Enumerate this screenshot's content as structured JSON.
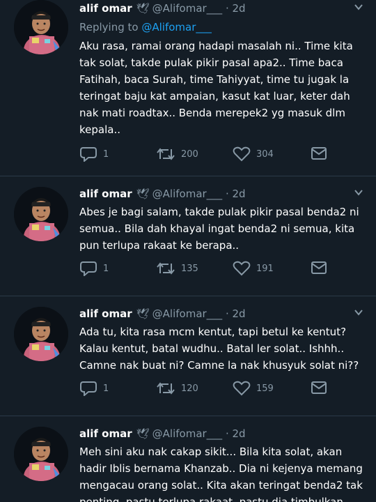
{
  "tweets": [
    {
      "name": "alif omar",
      "badge": "🕊",
      "handle": "@Alifomar___",
      "time": "2d",
      "reply_prefix": "Replying to",
      "reply_to": "@Alifomar___",
      "text": "Aku rasa, ramai orang hadapi masalah ni.. Time kita tak solat, takde pulak pikir pasal apa2.. Time baca Fatihah, baca Surah, time Tahiyyat, time tu jugak la teringat baju kat ampaian, kasut kat luar, keter dah nak mati roadtax.. Benda merepek2 yg masuk dlm kepala..",
      "replies": "1",
      "retweets": "200",
      "likes": "304"
    },
    {
      "name": "alif omar",
      "badge": "🕊",
      "handle": "@Alifomar___",
      "time": "2d",
      "text": "Abes je bagi salam, takde pulak pikir pasal benda2 ni semua.. Bila dah khayal ingat benda2 ni semua, kita pun terlupa rakaat ke berapa..",
      "replies": "1",
      "retweets": "135",
      "likes": "191"
    },
    {
      "name": "alif omar",
      "badge": "🕊",
      "handle": "@Alifomar___",
      "time": "2d",
      "text": "Ada tu, kita rasa mcm kentut, tapi betul ke kentut? Kalau kentut, batal wudhu.. Batal ler solat.. Ishhh.. Camne nak buat ni? Camne la nak khusyuk solat ni??",
      "replies": "1",
      "retweets": "120",
      "likes": "159"
    },
    {
      "name": "alif omar",
      "badge": "🕊",
      "handle": "@Alifomar___",
      "time": "2d",
      "text": "Meh sini aku nak cakap sikit... Bila kita solat, akan hadir Iblis bernama Khanzab.. Dia ni kejenya memang mengacau orang solat.. Kita akan teringat benda2 tak penting, pastu terlupa rakaat, pastu dia timbulkan"
    }
  ],
  "colors": {
    "background": "#141d26",
    "text": "#ffffff",
    "muted": "#8899a6",
    "link": "#1da1f2",
    "divider": "#2b3a48"
  }
}
